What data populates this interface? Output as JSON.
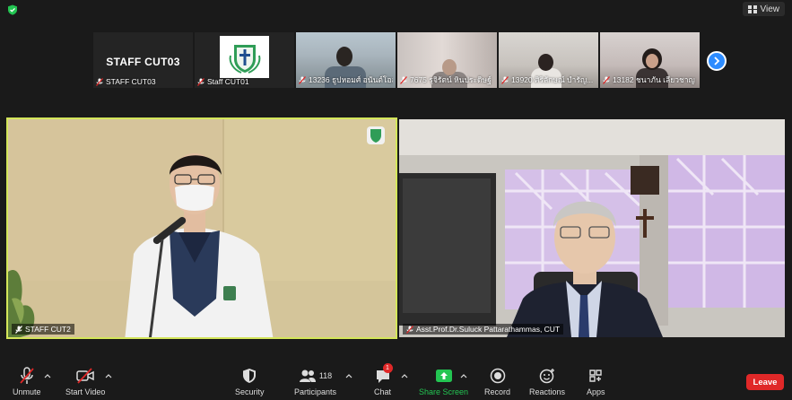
{
  "topbar": {
    "view_label": "View"
  },
  "thumbnails": [
    {
      "label": "STAFF CUT03",
      "banner": "STAFF CUT03"
    },
    {
      "label": "Staff CUT01"
    },
    {
      "label": "13236 ธูปหอมศ์ อนันต์โอสุ..."
    },
    {
      "label": "7675 รุจิรัตน์ หินประดิษฐ์"
    },
    {
      "label": "13920 ศิริลักษณ์ บำรัญ..."
    },
    {
      "label": "13182 ชนาภัน เลียวชาญ"
    }
  ],
  "main": {
    "left_label": "STAFF CUT2",
    "right_label": "Asst.Prof.Dr.Suluck Pattarathammas, CUT"
  },
  "toolbar": {
    "unmute": "Unmute",
    "start_video": "Start Video",
    "security": "Security",
    "participants": "Participants",
    "participants_count": "118",
    "chat": "Chat",
    "chat_badge": "1",
    "share_screen": "Share Screen",
    "record": "Record",
    "reactions": "Reactions",
    "apps": "Apps",
    "leave": "Leave"
  },
  "colors": {
    "accent": "#2d8cff",
    "share_green": "#23c552",
    "leave_red": "#e02828",
    "speaker_border": "#d4e65a"
  }
}
